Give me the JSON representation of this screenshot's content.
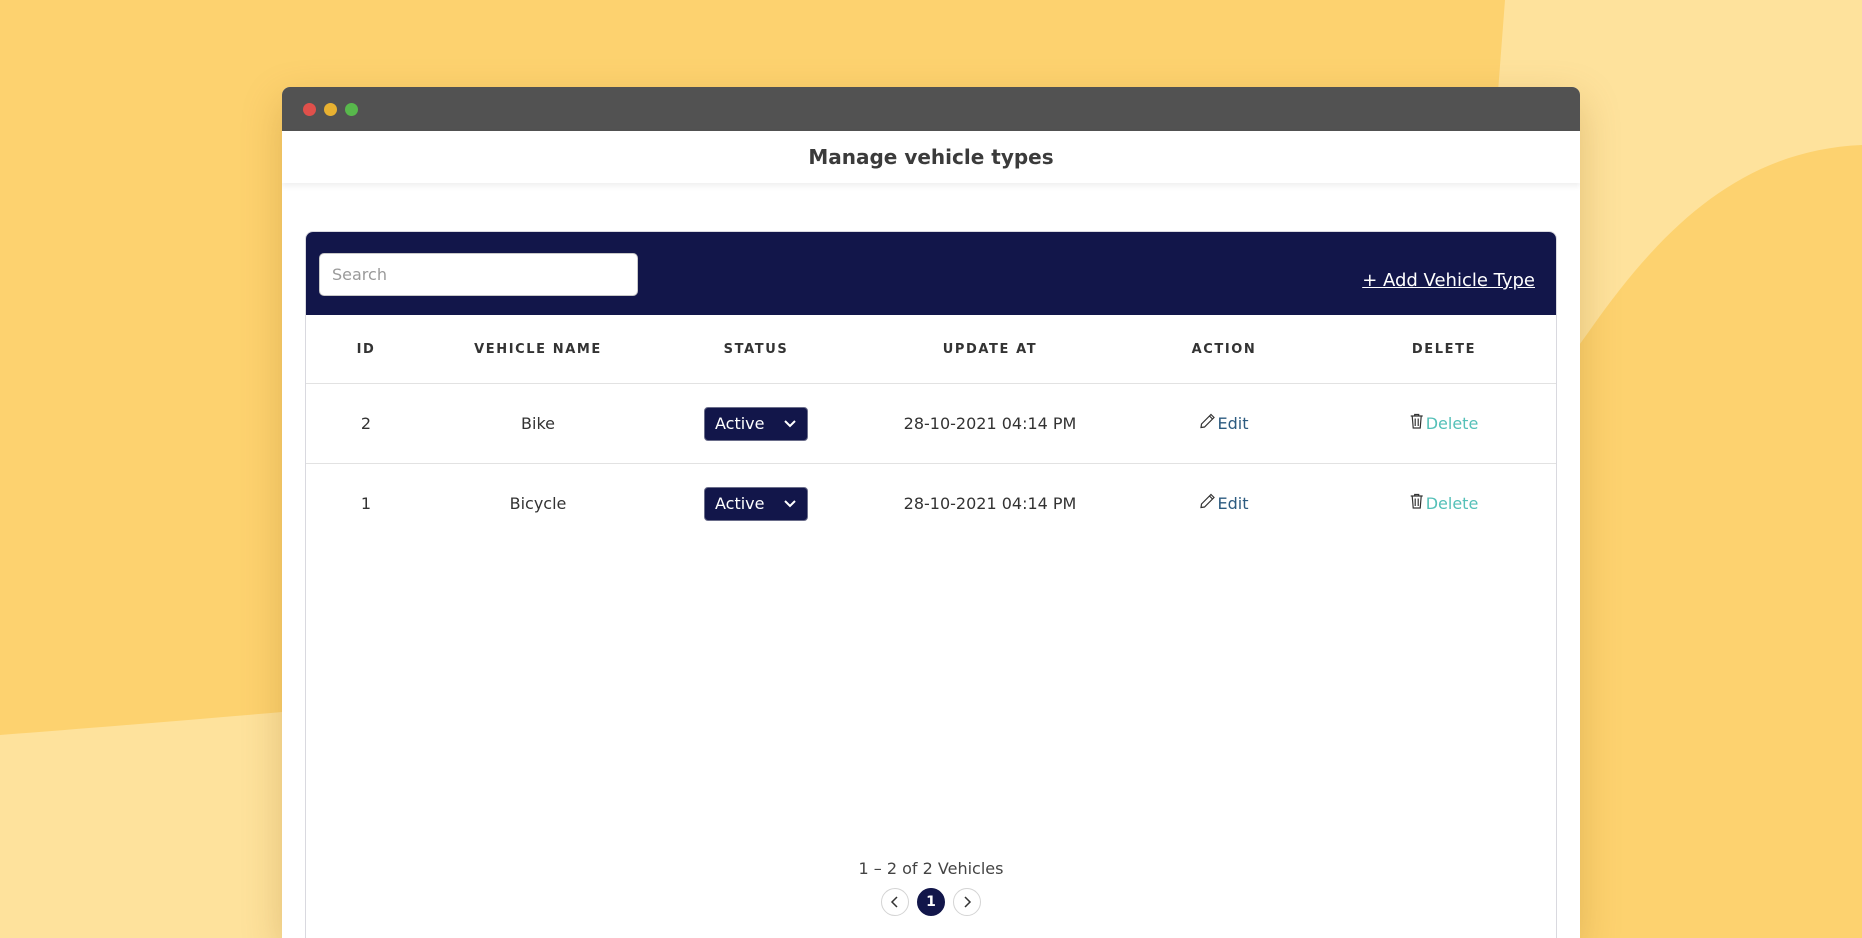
{
  "window": {
    "title": "Manage vehicle types"
  },
  "toolbar": {
    "search_placeholder": "Search",
    "search_value": "",
    "add_label": "+ Add Vehicle Type"
  },
  "table": {
    "headers": {
      "id": "ID",
      "name": "VEHICLE NAME",
      "status": "STATUS",
      "updated": "UPDATE AT",
      "action": "ACTION",
      "delete": "DELETE"
    },
    "rows": [
      {
        "id": "2",
        "name": "Bike",
        "status": "Active",
        "updated": "28-10-2021 04:14 PM",
        "action": "Edit",
        "delete": "Delete"
      },
      {
        "id": "1",
        "name": "Bicycle",
        "status": "Active",
        "updated": "28-10-2021 04:14 PM",
        "action": "Edit",
        "delete": "Delete"
      }
    ]
  },
  "pagination": {
    "summary": "1 – 2 of 2 Vehicles",
    "current_page": "1"
  },
  "colors": {
    "background": "#fdd26f",
    "navy": "#12164a",
    "edit_link": "#2c5b80",
    "delete_link": "#55c0b8"
  },
  "icons": [
    "pencil-icon",
    "trash-icon",
    "chevron-down-icon",
    "chevron-left-icon",
    "chevron-right-icon"
  ]
}
